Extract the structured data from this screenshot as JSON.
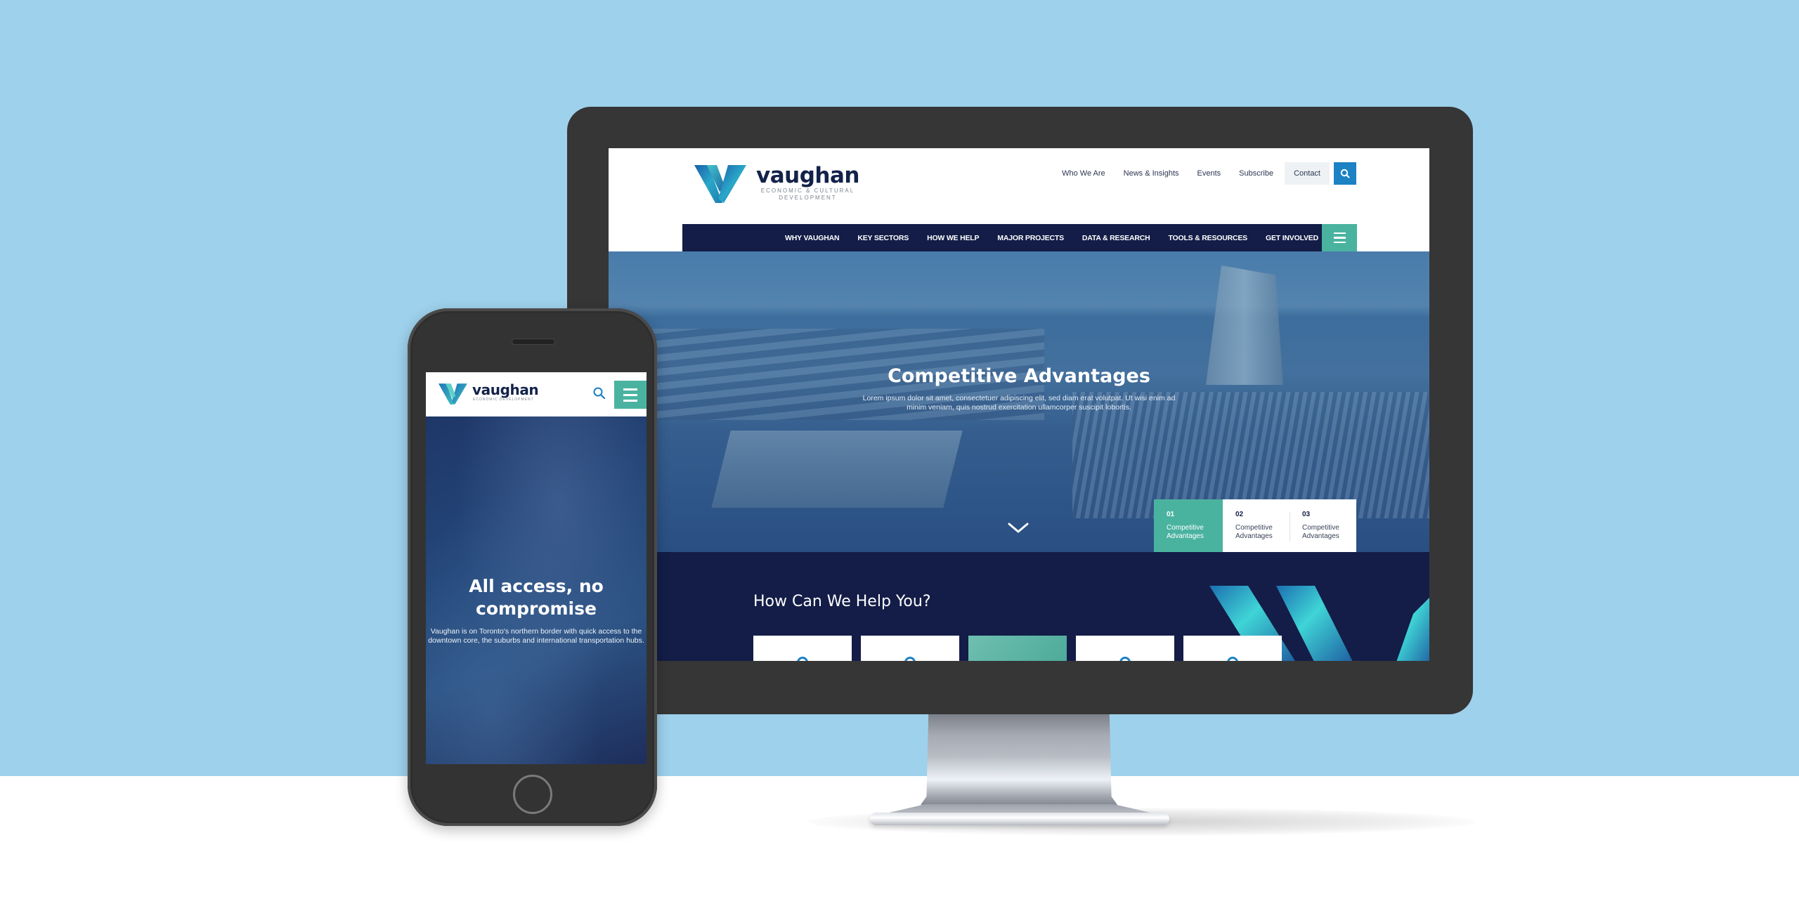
{
  "colors": {
    "background_blue": "#9ed1ec",
    "navy": "#131d47",
    "teal": "#4ab3a0",
    "search_blue": "#1b82c4",
    "bezel": "#363636"
  },
  "desktop": {
    "logo": {
      "wordmark": "vaughan",
      "tagline_line1": "ECONOMIC & CULTURAL",
      "tagline_line2": "DEVELOPMENT"
    },
    "utility_nav": [
      {
        "label": "Who We Are"
      },
      {
        "label": "News & Insights"
      },
      {
        "label": "Events"
      },
      {
        "label": "Subscribe"
      },
      {
        "label": "Contact"
      }
    ],
    "search_icon": "search-icon",
    "main_nav": [
      {
        "label": "WHY VAUGHAN"
      },
      {
        "label": "KEY SECTORS"
      },
      {
        "label": "HOW WE HELP"
      },
      {
        "label": "MAJOR PROJECTS"
      },
      {
        "label": "DATA & RESEARCH"
      },
      {
        "label": "TOOLS & RESOURCES"
      },
      {
        "label": "GET INVOLVED"
      }
    ],
    "menu_icon": "hamburger-icon",
    "hero": {
      "title": "Competitive Advantages",
      "text": "Lorem ipsum dolor sit amet, consectetuer adipiscing elit, sed diam erat volutpat. Ut wisi enim ad minim veniam, quis nostrud exercitation ullamcorper suscipit lobortis.",
      "scroll_icon": "chevron-down-icon",
      "tabs": [
        {
          "number": "01",
          "label": "Competitive Advantages",
          "active": true
        },
        {
          "number": "02",
          "label": "Competitive Advantages",
          "active": false
        },
        {
          "number": "03",
          "label": "Competitive Advantages",
          "active": false
        }
      ]
    },
    "help": {
      "title": "How Can We Help You?",
      "cards": [
        {
          "style": "white"
        },
        {
          "style": "white"
        },
        {
          "style": "teal"
        },
        {
          "style": "white"
        },
        {
          "style": "white"
        }
      ]
    }
  },
  "mobile": {
    "logo": {
      "wordmark": "vaughan",
      "tagline": "ECONOMIC DEVELOPMENT"
    },
    "search_icon": "search-icon",
    "menu_icon": "hamburger-icon",
    "hero": {
      "title_line1": "All access, no",
      "title_line2": "compromise",
      "text": "Vaughan is on Toronto's northern border with quick access to the downtown core, the suburbs and international transportation hubs."
    }
  }
}
